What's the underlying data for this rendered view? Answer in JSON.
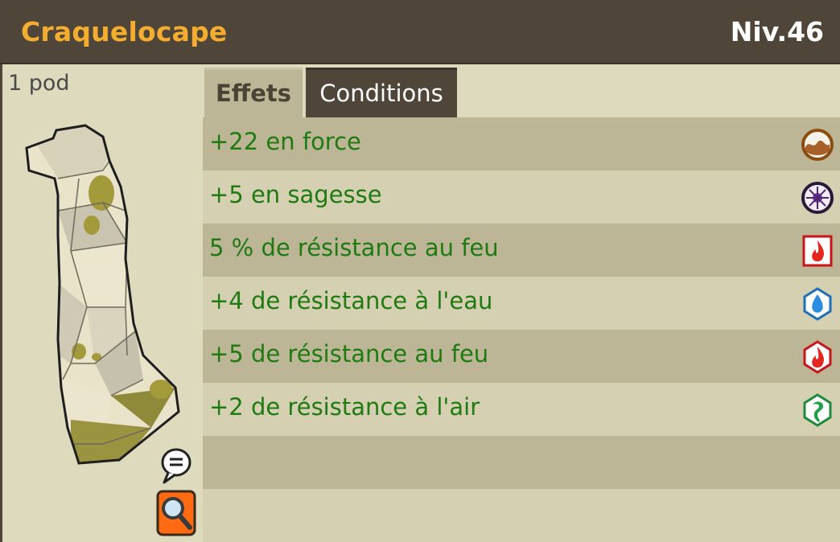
{
  "item": {
    "name": "Craquelocape",
    "level": "Niv.46",
    "weight": "1 pod"
  },
  "tabs": [
    {
      "label": "Effets",
      "active": true
    },
    {
      "label": "Conditions",
      "active": false
    }
  ],
  "effects": [
    {
      "text": "+22 en force",
      "icon": "earth-strength-icon"
    },
    {
      "text": "+5 en sagesse",
      "icon": "wisdom-icon"
    },
    {
      "text": "5 % de résistance au feu",
      "icon": "fire-percent-resistance-icon"
    },
    {
      "text": "+4 de résistance à l'eau",
      "icon": "water-icon"
    },
    {
      "text": "+5 de résistance au feu",
      "icon": "fire-icon"
    },
    {
      "text": "+2 de résistance à l'air",
      "icon": "air-icon"
    }
  ],
  "colors": {
    "header_bg": "#4f4639",
    "item_name": "#f4ad2f",
    "effect_text": "#1f7a12",
    "row_dark": "#bdb696",
    "row_light": "#d5d0b2"
  }
}
